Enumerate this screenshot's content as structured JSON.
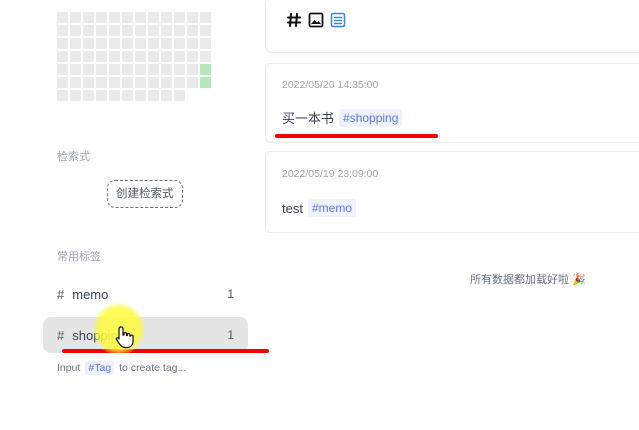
{
  "sidebar": {
    "heatmap": {
      "rows": [
        [
          0,
          0,
          0,
          0,
          0,
          0,
          0,
          0,
          0,
          0,
          0,
          0
        ],
        [
          0,
          0,
          0,
          0,
          0,
          0,
          0,
          0,
          0,
          0,
          0,
          0
        ],
        [
          0,
          0,
          0,
          0,
          0,
          0,
          0,
          0,
          0,
          0,
          0,
          0
        ],
        [
          0,
          0,
          0,
          0,
          0,
          0,
          0,
          0,
          0,
          0,
          0,
          0
        ],
        [
          0,
          0,
          0,
          0,
          0,
          0,
          0,
          0,
          0,
          0,
          0,
          1
        ],
        [
          0,
          0,
          0,
          0,
          0,
          0,
          0,
          0,
          0,
          0,
          0,
          1
        ],
        [
          0,
          0,
          0,
          0,
          0,
          0,
          0,
          0,
          0,
          0,
          null,
          null
        ]
      ],
      "colors": {
        "empty": "#eaeaea",
        "level1": "#b5e6bc"
      }
    },
    "query_section": {
      "title": "检索式",
      "create_button": "创建检索式"
    },
    "tags_section": {
      "title": "常用标签",
      "items": [
        {
          "hash": "#",
          "name": "memo",
          "count": "1",
          "active": false
        },
        {
          "hash": "#",
          "name": "shopping",
          "count": "1",
          "active": true
        }
      ]
    },
    "tag_hint": {
      "prefix": "Input",
      "chip": "#Tag",
      "suffix": "to create tag..."
    }
  },
  "editor": {
    "tools": [
      "hash-icon",
      "image-icon",
      "list-icon"
    ],
    "accent_color": "#3b82f6"
  },
  "memos": [
    {
      "time": "2022/05/20 14:35:00",
      "text": "买一本书",
      "tag": "#shopping"
    },
    {
      "time": "2022/05/19 23:09:00",
      "text": "test",
      "tag": "#memo"
    }
  ],
  "footer": {
    "all_loaded": "所有数据都加载好啦 🎉"
  },
  "annotation_color": "#f20000"
}
